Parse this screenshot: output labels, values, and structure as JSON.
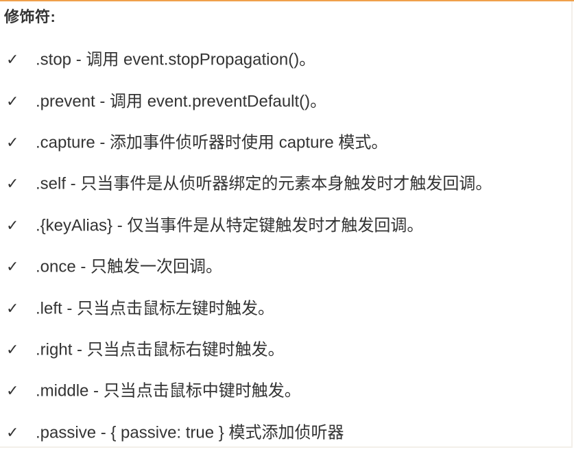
{
  "title": "修饰符:",
  "items": [
    {
      "icon": "check-icon",
      "text": ".stop - 调用 event.stopPropagation()。"
    },
    {
      "icon": "check-icon",
      "text": ".prevent - 调用 event.preventDefault()。"
    },
    {
      "icon": "check-icon",
      "text": ".capture - 添加事件侦听器时使用 capture 模式。"
    },
    {
      "icon": "check-icon",
      "text": ".self - 只当事件是从侦听器绑定的元素本身触发时才触发回调。"
    },
    {
      "icon": "check-icon",
      "text": ".{keyAlias} - 仅当事件是从特定键触发时才触发回调。"
    },
    {
      "icon": "check-icon",
      "text": ".once - 只触发一次回调。"
    },
    {
      "icon": "check-icon",
      "text": ".left - 只当点击鼠标左键时触发。"
    },
    {
      "icon": "check-icon",
      "text": ".right - 只当点击鼠标右键时触发。"
    },
    {
      "icon": "check-icon",
      "text": ".middle - 只当点击鼠标中键时触发。"
    },
    {
      "icon": "check-icon",
      "text": ".passive - { passive: true } 模式添加侦听器"
    }
  ],
  "colors": {
    "accent_rule": "#f0a04b",
    "text": "#333333",
    "background": "#ffffff"
  }
}
